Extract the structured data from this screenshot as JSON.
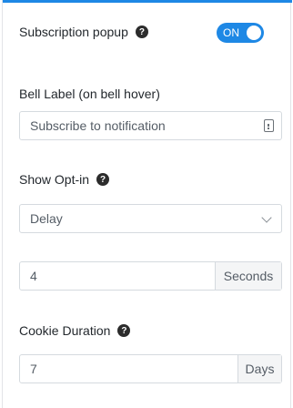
{
  "subscription": {
    "label": "Subscription popup",
    "toggle_state": "ON"
  },
  "bell_label": {
    "label": "Bell Label (on bell hover)",
    "value": "Subscribe to notification"
  },
  "show_optin": {
    "label": "Show Opt-in",
    "selected": "Delay",
    "delay_value": "4",
    "delay_unit": "Seconds"
  },
  "cookie": {
    "label": "Cookie Duration",
    "value": "7",
    "unit": "Days"
  },
  "help_glyph": "?",
  "colors": {
    "accent": "#1e88e5",
    "help_bg": "#2c2c2c",
    "border": "#d5dadf"
  }
}
